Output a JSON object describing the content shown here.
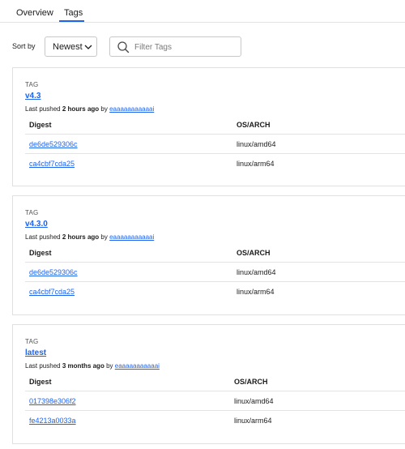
{
  "tabs": [
    {
      "label": "Overview"
    },
    {
      "label": "Tags"
    }
  ],
  "toolbar": {
    "sort_label": "Sort by",
    "sort_value": "Newest",
    "search_placeholder": "Filter Tags"
  },
  "tag_kicker": "TAG",
  "pushed_prefix": "Last pushed",
  "pushed_by": "by",
  "table_headers": {
    "digest": "Digest",
    "os_arch": "OS/ARCH"
  },
  "tags": [
    {
      "name": "v4.3",
      "pushed_when": "2 hours ago",
      "pushed_user": "eaaaaaaaaaaai",
      "rows": [
        {
          "digest": "de6de529306c",
          "os_arch": "linux/amd64"
        },
        {
          "digest": "ca4cbf7cda25",
          "os_arch": "linux/arm64"
        }
      ]
    },
    {
      "name": "v4.3.0",
      "pushed_when": "2 hours ago",
      "pushed_user": "eaaaaaaaaaaai",
      "rows": [
        {
          "digest": "de6de529306c",
          "os_arch": "linux/amd64"
        },
        {
          "digest": "ca4cbf7cda25",
          "os_arch": "linux/arm64"
        }
      ]
    },
    {
      "name": "latest",
      "pushed_when": "3 months ago",
      "pushed_user": "eaaaaaaaaaaai",
      "rows": [
        {
          "digest": "017398e306f2",
          "os_arch": "linux/amd64"
        },
        {
          "digest": "fe4213a0033a",
          "os_arch": "linux/arm64"
        }
      ]
    }
  ],
  "colors": {
    "accent": "#1d63ed",
    "border": "#e0e0e0"
  }
}
